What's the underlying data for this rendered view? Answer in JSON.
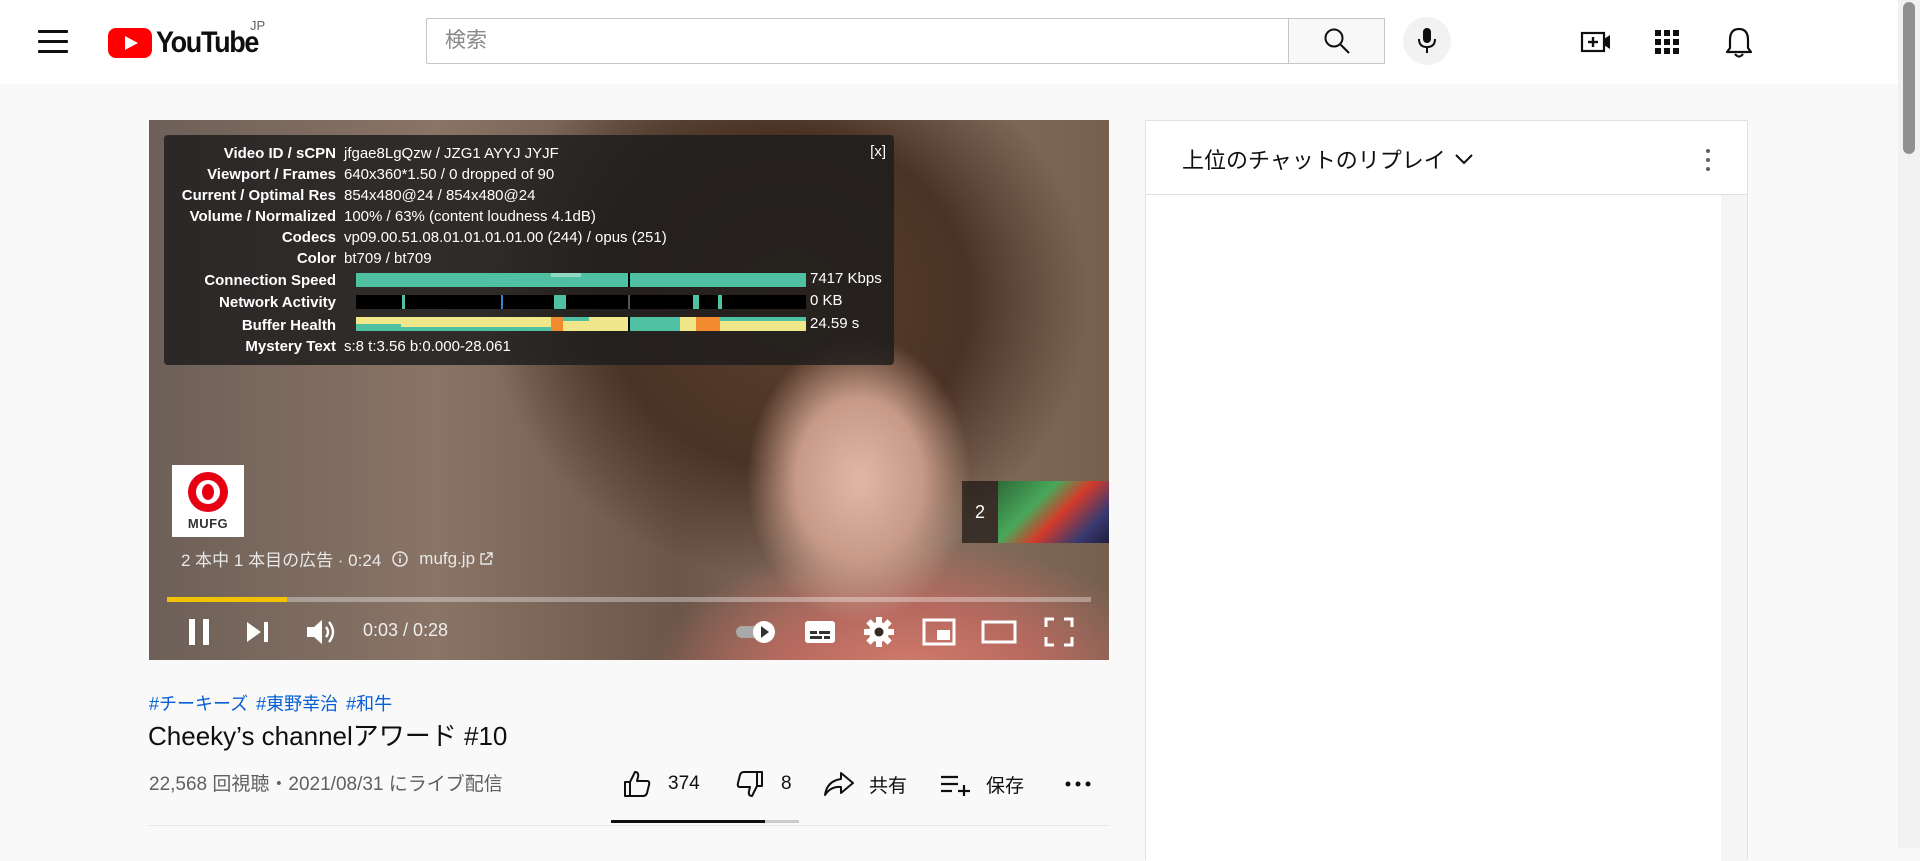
{
  "header": {
    "logo_text": "YouTube",
    "country_code": "JP",
    "search": {
      "placeholder": "検索",
      "value": ""
    }
  },
  "icons": {
    "menu": "menu-icon",
    "search": "search-icon",
    "mic": "mic-icon",
    "create": "create-video-icon",
    "apps": "apps-grid-icon",
    "notifications": "bell-icon"
  },
  "player": {
    "stats": {
      "close_label": "[x]",
      "rows": [
        {
          "label": "Video ID / sCPN",
          "value": "jfgae8LgQzw / JZG1 AYYJ JYJF"
        },
        {
          "label": "Viewport / Frames",
          "value": "640x360*1.50 / 0 dropped of 90"
        },
        {
          "label": "Current / Optimal Res",
          "value": "854x480@24 / 854x480@24"
        },
        {
          "label": "Volume / Normalized",
          "value": "100% / 63% (content loudness 4.1dB)"
        },
        {
          "label": "Codecs",
          "value": "vp09.00.51.08.01.01.01.01.00 (244) / opus (251)"
        },
        {
          "label": "Color",
          "value": "bt709 / bt709"
        },
        {
          "label": "Connection Speed",
          "value": "7417 Kbps"
        },
        {
          "label": "Network Activity",
          "value": "0 KB"
        },
        {
          "label": "Buffer Health",
          "value": "24.59 s"
        },
        {
          "label": "Mystery Text",
          "value": "s:8 t:3.56 b:0.000-28.061"
        }
      ]
    },
    "ad": {
      "sponsor_name": "MUFG",
      "info_text": "2 本中 1 本目の広告 · 0:24",
      "link_text": "mufg.jp",
      "next_count": "2"
    },
    "progress_fraction": 0.13,
    "time_display": "0:03 / 0:28"
  },
  "video": {
    "hashtags": [
      "#チーキーズ",
      "#東野幸治",
      "#和牛"
    ],
    "title": "Cheeky’s channelアワード #10",
    "meta": "22,568 回視聴・2021/08/31 にライブ配信",
    "like_count": "374",
    "dislike_count": "8",
    "share_label": "共有",
    "save_label": "保存",
    "like_fraction": 0.82
  },
  "chat": {
    "title": "上位のチャットのリプレイ"
  },
  "colors": {
    "brand_red": "#ff0000",
    "progress_ad": "#f2c200",
    "link_blue": "#065fd4",
    "graph_teal": "#4fc1a2",
    "graph_yellow": "#f0e78a",
    "graph_orange": "#f28b30"
  }
}
